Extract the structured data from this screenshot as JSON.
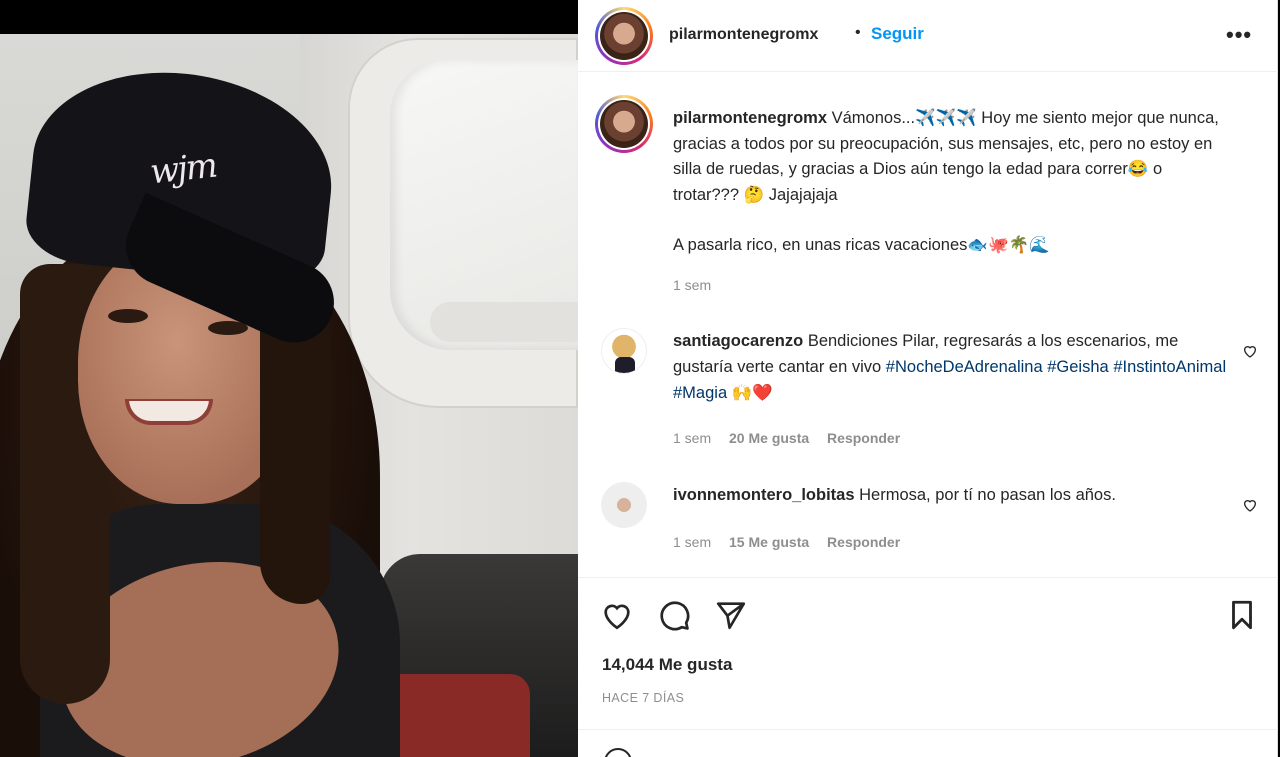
{
  "post": {
    "author": "pilarmontenegromx",
    "follow_label": "Seguir",
    "separator": "•",
    "more_label": "•••"
  },
  "caption": {
    "author": "pilarmontenegromx",
    "text": "Vámonos...✈️✈️✈️ Hoy me siento mejor que nunca, gracias a todos por su preocupación, sus mensajes, etc, pero no estoy en silla de ruedas, y gracias a Dios aún tengo la edad para correr😂 o trotar??? 🤔 Jajajajaja",
    "text2": "A pasarla rico, en unas ricas vacaciones🐟🐙🌴🌊",
    "time": "1 sem"
  },
  "comments": [
    {
      "author": "santiagocarenzo",
      "text": "Bendiciones Pilar, regresarás a los escenarios, me gustaría verte cantar en vivo",
      "tags": [
        "#NocheDeAdrenalina",
        "#Geisha",
        "#InstintoAnimal",
        "#Magia"
      ],
      "trail": "🙌❤️",
      "time": "1 sem",
      "likes": "20 Me gusta",
      "reply": "Responder"
    },
    {
      "author": "ivonnemontero_lobitas",
      "text": "Hermosa, por tí no pasan los años.",
      "time": "1 sem",
      "likes": "15 Me gusta",
      "reply": "Responder"
    }
  ],
  "likes_label": "14,044 Me gusta",
  "date_label": "HACE 7 DÍAS",
  "photo": {
    "cap_logo": "wjm"
  },
  "icons": [
    "heart-icon",
    "comment-icon",
    "share-icon",
    "bookmark-icon",
    "more-icon",
    "emoji-icon"
  ],
  "colors": {
    "accent": "#0095f6",
    "hashtag": "#00376b",
    "heart": "#ed4956",
    "muted": "#8e8e8e"
  }
}
